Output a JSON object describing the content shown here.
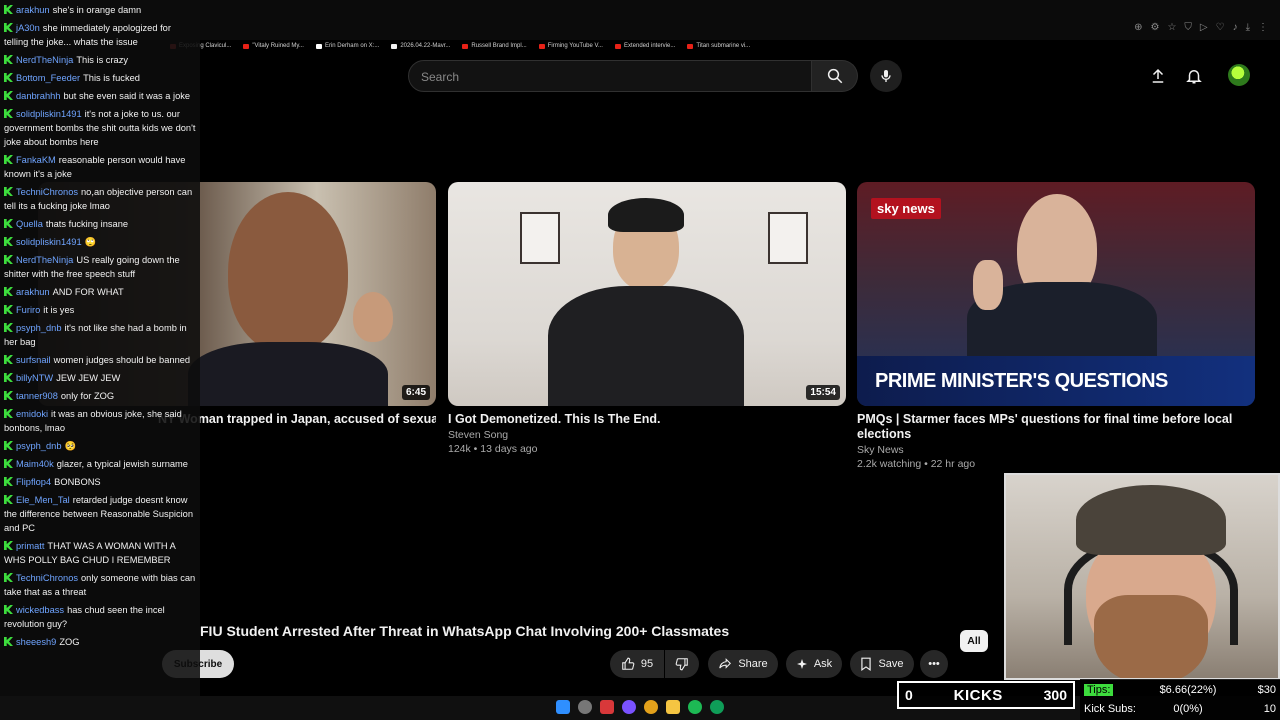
{
  "browser": {
    "bookmarks": [
      {
        "label": "Exposing Clavicul...",
        "color": "#d9383a"
      },
      {
        "label": "\"Vitaly Ruined My...",
        "color": "#e62117"
      },
      {
        "label": "Erin Derham on X:...",
        "color": "#ffffff"
      },
      {
        "label": "2026.04.22-Mavr...",
        "color": "#f1f1f1"
      },
      {
        "label": "Russell Brand Impl...",
        "color": "#e62117"
      },
      {
        "label": "Firming YouTube V...",
        "color": "#e62117"
      },
      {
        "label": "Extended intervie...",
        "color": "#e62117"
      },
      {
        "label": "Titan submarine vi...",
        "color": "#e62117"
      }
    ]
  },
  "header": {
    "search_placeholder": "Search",
    "icons": [
      "search-icon",
      "mic-icon",
      "upload-icon",
      "bell-icon",
      "avatar"
    ]
  },
  "videos": [
    {
      "title": "NY Woman trapped in Japan, accused of sexual assault, fighting",
      "channel": "",
      "meta": "",
      "duration": "6:45"
    },
    {
      "title": "I Got Demonetized. This Is The End.",
      "channel": "Steven Song",
      "meta": "124k • 13 days ago",
      "duration": "15:54"
    },
    {
      "title": "PMQs | Starmer faces MPs' questions for final time before local elections",
      "channel": "Sky News",
      "meta": "2.2k watching • 22 hr ago",
      "duration": "",
      "overlay_text": "PRIME MINISTER'S QUESTIONS",
      "logo": "sky news"
    }
  ],
  "watch": {
    "title": "FIU Student Arrested After Threat in WhatsApp Chat Involving 200+ Classmates",
    "subscribe_label": "Subscribe",
    "like_count": "95",
    "share_label": "Share",
    "ask_label": "Ask",
    "save_label": "Save",
    "chip_all": "All"
  },
  "chat": [
    {
      "user": "arakhun",
      "text": "she's in orange damn"
    },
    {
      "user": "jA30n",
      "text": "she immediately apologized for telling the joke... whats the issue"
    },
    {
      "user": "NerdTheNinja",
      "text": "This is crazy"
    },
    {
      "user": "Bottom_Feeder",
      "text": "This is fucked"
    },
    {
      "user": "danbrahhh",
      "text": "but she even said it was a joke"
    },
    {
      "user": "solidpliskin1491",
      "text": "it's not a joke to us. our government bombs the shit outta kids we don't joke about bombs here"
    },
    {
      "user": "FankaKM",
      "text": "reasonable person would have known it's a joke"
    },
    {
      "user": "TechniChronos",
      "text": "no,an objective person can tell its a fucking joke lmao"
    },
    {
      "user": "Quella",
      "text": "thats fucking insane"
    },
    {
      "user": "solidpliskin1491",
      "text": "🙄"
    },
    {
      "user": "NerdTheNinja",
      "text": "US really going down the shitter with the free speech stuff"
    },
    {
      "user": "arakhun",
      "text": "AND FOR WHAT"
    },
    {
      "user": "Furiro",
      "text": "it is yes"
    },
    {
      "user": "psyph_dnb",
      "text": "it's not like she had a bomb in her bag"
    },
    {
      "user": "surfsnail",
      "text": "women judges should be banned"
    },
    {
      "user": "billyNTW",
      "text": "JEW JEW JEW"
    },
    {
      "user": "tanner908",
      "text": "only for ZOG"
    },
    {
      "user": "emidoki",
      "text": "it was an obvious joke, she said bonbons, lmao"
    },
    {
      "user": "psyph_dnb",
      "text": "🥺"
    },
    {
      "user": "Maim40k",
      "text": "glazer, a typical jewish surname"
    },
    {
      "user": "Flipflop4",
      "text": "BONBONS"
    },
    {
      "user": "Ele_Men_Tal",
      "text": "retarded judge doesnt know the difference between Reasonable Suspicion and PC"
    },
    {
      "user": "primatt",
      "text": "THAT WAS A WOMAN WITH A WHS POLLY BAG CHUD I REMEMBER"
    },
    {
      "user": "TechniChronos",
      "text": "only someone with bias can take that as a threat"
    },
    {
      "user": "wickedbass",
      "text": "has chud seen the incel revolution guy?"
    },
    {
      "user": "sheeesh9",
      "text": "ZOG"
    }
  ],
  "stream": {
    "kicks_count": "0",
    "kicks_label": "KICKS",
    "kicks_goal": "300",
    "tips_label": "Tips:",
    "tips_value": "$6.66(22%)",
    "tips_goal": "$30",
    "subs_label": "Kick Subs:",
    "subs_value": "0(0%)",
    "subs_goal": "10"
  },
  "colors": {
    "kick_green": "#3ddc3d",
    "username_blue": "#6fa4ff",
    "yt_red": "#e62117",
    "sky_red": "#b3121f"
  }
}
